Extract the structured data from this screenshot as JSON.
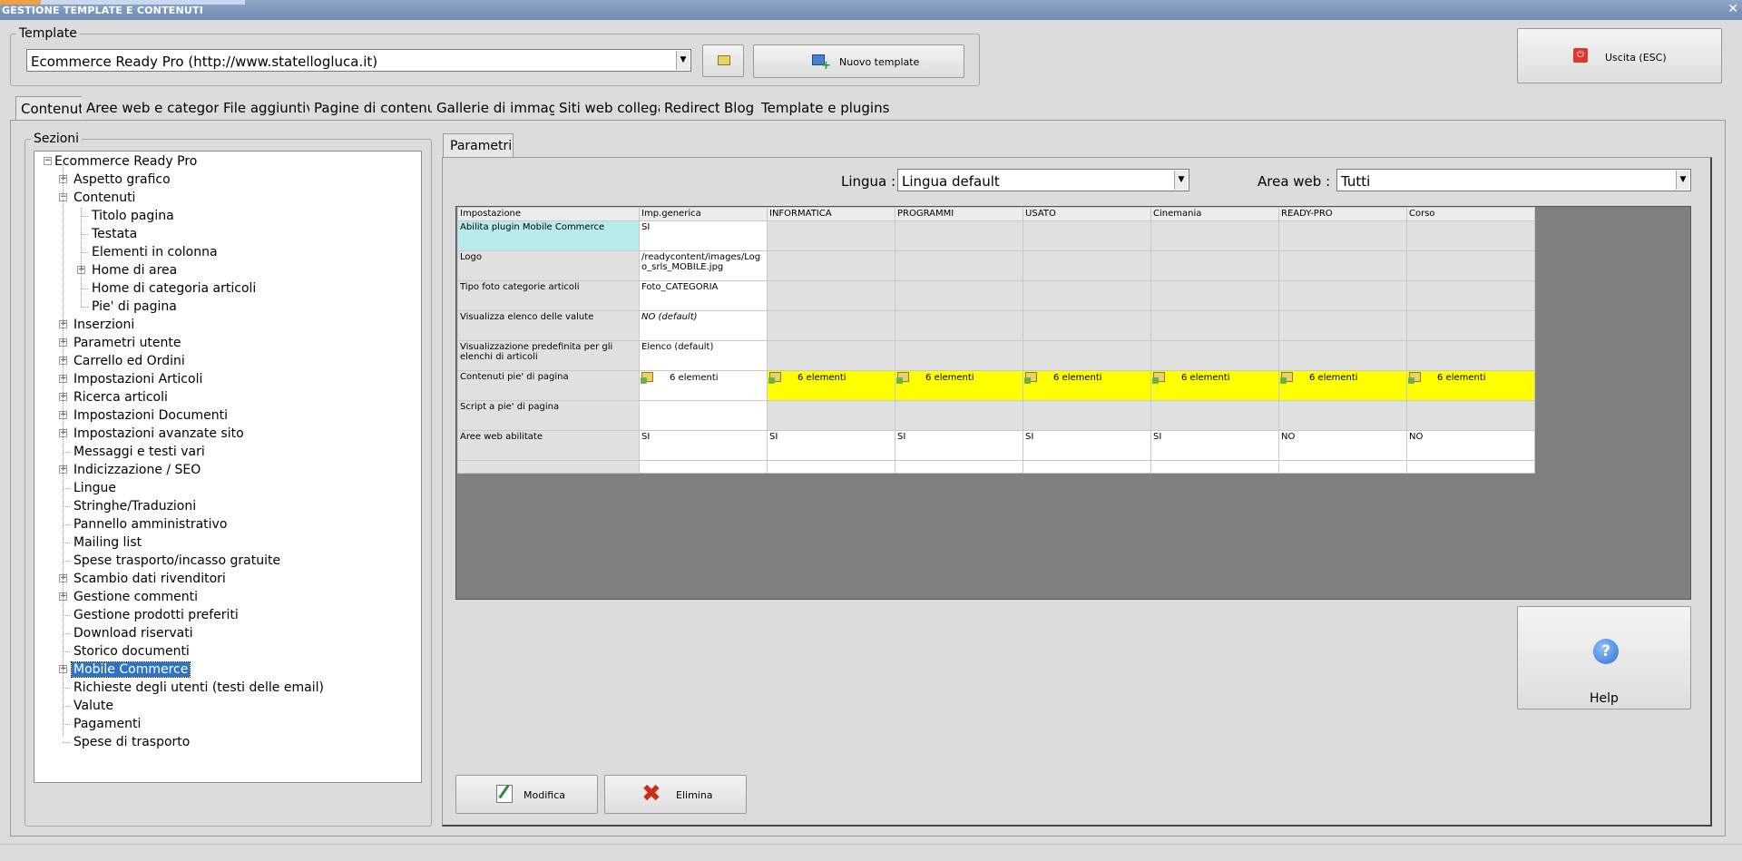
{
  "window": {
    "title": "GESTIONE TEMPLATE E CONTENUTI",
    "close_glyph": "✕"
  },
  "template": {
    "group_label": "Template",
    "selected": "Ecommerce Ready Pro (http://www.statellogluca.it)",
    "new_button": "Nuovo template"
  },
  "exit_button": "Uscita (ESC)",
  "tabs": [
    "Contenuti",
    "Aree web e categorie",
    "File aggiuntivi",
    "Pagine di contenuti",
    "Gallerie di immagini",
    "Siti web collegati",
    "Redirect",
    "Blog",
    "Template e plugins"
  ],
  "sections_label": "Sezioni",
  "tree": [
    {
      "label": "Ecommerce Ready Pro",
      "level": 0,
      "toggle": "−"
    },
    {
      "label": "Aspetto grafico",
      "level": 1,
      "toggle": "+"
    },
    {
      "label": "Contenuti",
      "level": 1,
      "toggle": "−"
    },
    {
      "label": "Titolo pagina",
      "level": 2,
      "toggle": ""
    },
    {
      "label": "Testata",
      "level": 2,
      "toggle": ""
    },
    {
      "label": "Elementi in colonna",
      "level": 2,
      "toggle": ""
    },
    {
      "label": "Home di area",
      "level": 2,
      "toggle": "+"
    },
    {
      "label": "Home di categoria articoli",
      "level": 2,
      "toggle": ""
    },
    {
      "label": "Pie' di pagina",
      "level": 2,
      "toggle": ""
    },
    {
      "label": "Inserzioni",
      "level": 1,
      "toggle": "+"
    },
    {
      "label": "Parametri utente",
      "level": 1,
      "toggle": "+"
    },
    {
      "label": "Carrello ed Ordini",
      "level": 1,
      "toggle": "+"
    },
    {
      "label": "Impostazioni Articoli",
      "level": 1,
      "toggle": "+"
    },
    {
      "label": "Ricerca articoli",
      "level": 1,
      "toggle": "+"
    },
    {
      "label": "Impostazioni Documenti",
      "level": 1,
      "toggle": "+"
    },
    {
      "label": "Impostazioni avanzate sito",
      "level": 1,
      "toggle": "+"
    },
    {
      "label": "Messaggi e testi vari",
      "level": 1,
      "toggle": ""
    },
    {
      "label": "Indicizzazione / SEO",
      "level": 1,
      "toggle": "+"
    },
    {
      "label": "Lingue",
      "level": 1,
      "toggle": ""
    },
    {
      "label": "Stringhe/Traduzioni",
      "level": 1,
      "toggle": ""
    },
    {
      "label": "Pannello amministrativo",
      "level": 1,
      "toggle": ""
    },
    {
      "label": "Mailing list",
      "level": 1,
      "toggle": ""
    },
    {
      "label": "Spese trasporto/incasso gratuite",
      "level": 1,
      "toggle": ""
    },
    {
      "label": "Scambio dati rivenditori",
      "level": 1,
      "toggle": "+"
    },
    {
      "label": "Gestione commenti",
      "level": 1,
      "toggle": "+"
    },
    {
      "label": "Gestione prodotti preferiti",
      "level": 1,
      "toggle": ""
    },
    {
      "label": "Download riservati",
      "level": 1,
      "toggle": ""
    },
    {
      "label": "Storico documenti",
      "level": 1,
      "toggle": ""
    },
    {
      "label": "Mobile Commerce",
      "level": 1,
      "toggle": "+",
      "selected": true
    },
    {
      "label": "Richieste degli utenti (testi delle email)",
      "level": 1,
      "toggle": ""
    },
    {
      "label": "Valute",
      "level": 1,
      "toggle": ""
    },
    {
      "label": "Pagamenti",
      "level": 1,
      "toggle": ""
    },
    {
      "label": "Spese di trasporto",
      "level": 1,
      "toggle": ""
    }
  ],
  "params_tab": "Parametri",
  "filters": {
    "lingua_label": "Lingua :",
    "lingua_value": "Lingua default",
    "area_label": "Area web :",
    "area_value": "Tutti"
  },
  "grid": {
    "headers": [
      "Impostazione",
      "Imp.generica",
      "INFORMATICA",
      "PROGRAMMI",
      "USATO",
      "Cinemania",
      "READY-PRO",
      "Corso"
    ],
    "rows": [
      {
        "cells": [
          "Abilita plugin Mobile Commerce",
          "SI",
          "",
          "",
          "",
          "",
          "",
          ""
        ],
        "style": "cyan"
      },
      {
        "cells": [
          "Logo",
          "/readycontent/images/Logo_srls_MOBILE.jpg",
          "",
          "",
          "",
          "",
          "",
          ""
        ],
        "style": ""
      },
      {
        "cells": [
          "Tipo foto categorie articoli",
          "Foto_CATEGORIA",
          "",
          "",
          "",
          "",
          "",
          ""
        ],
        "style": ""
      },
      {
        "cells": [
          "Visualizza elenco delle valute",
          "NO (default)",
          "",
          "",
          "",
          "",
          "",
          ""
        ],
        "style": "italic"
      },
      {
        "cells": [
          "Visualizzazione predefinita per gli elenchi di articoli",
          "Elenco (default)",
          "",
          "",
          "",
          "",
          "",
          ""
        ],
        "style": ""
      },
      {
        "cells": [
          "Contenuti pie' di pagina",
          "6 elementi",
          "6 elementi",
          "6 elementi",
          "6 elementi",
          "6 elementi",
          "6 elementi",
          "6 elementi"
        ],
        "style": "folder"
      },
      {
        "cells": [
          "Script a pie' di pagina",
          "",
          "",
          "",
          "",
          "",
          "",
          ""
        ],
        "style": ""
      },
      {
        "cells": [
          "Aree web abilitate",
          "SI",
          "SI",
          "SI",
          "SI",
          "SI",
          "NO",
          "NO"
        ],
        "style": "white"
      },
      {
        "cells": [
          "",
          "",
          "",
          "",
          "",
          "",
          "",
          ""
        ],
        "style": "white"
      }
    ]
  },
  "help_button": "Help",
  "actions": {
    "edit": "Modifica",
    "delete": "Elimina"
  },
  "colors": {
    "titlebar": "#7891b8",
    "highlight_yellow": "#ffff00",
    "highlight_cyan": "#b8ecec",
    "selection": "#2e74c2"
  }
}
